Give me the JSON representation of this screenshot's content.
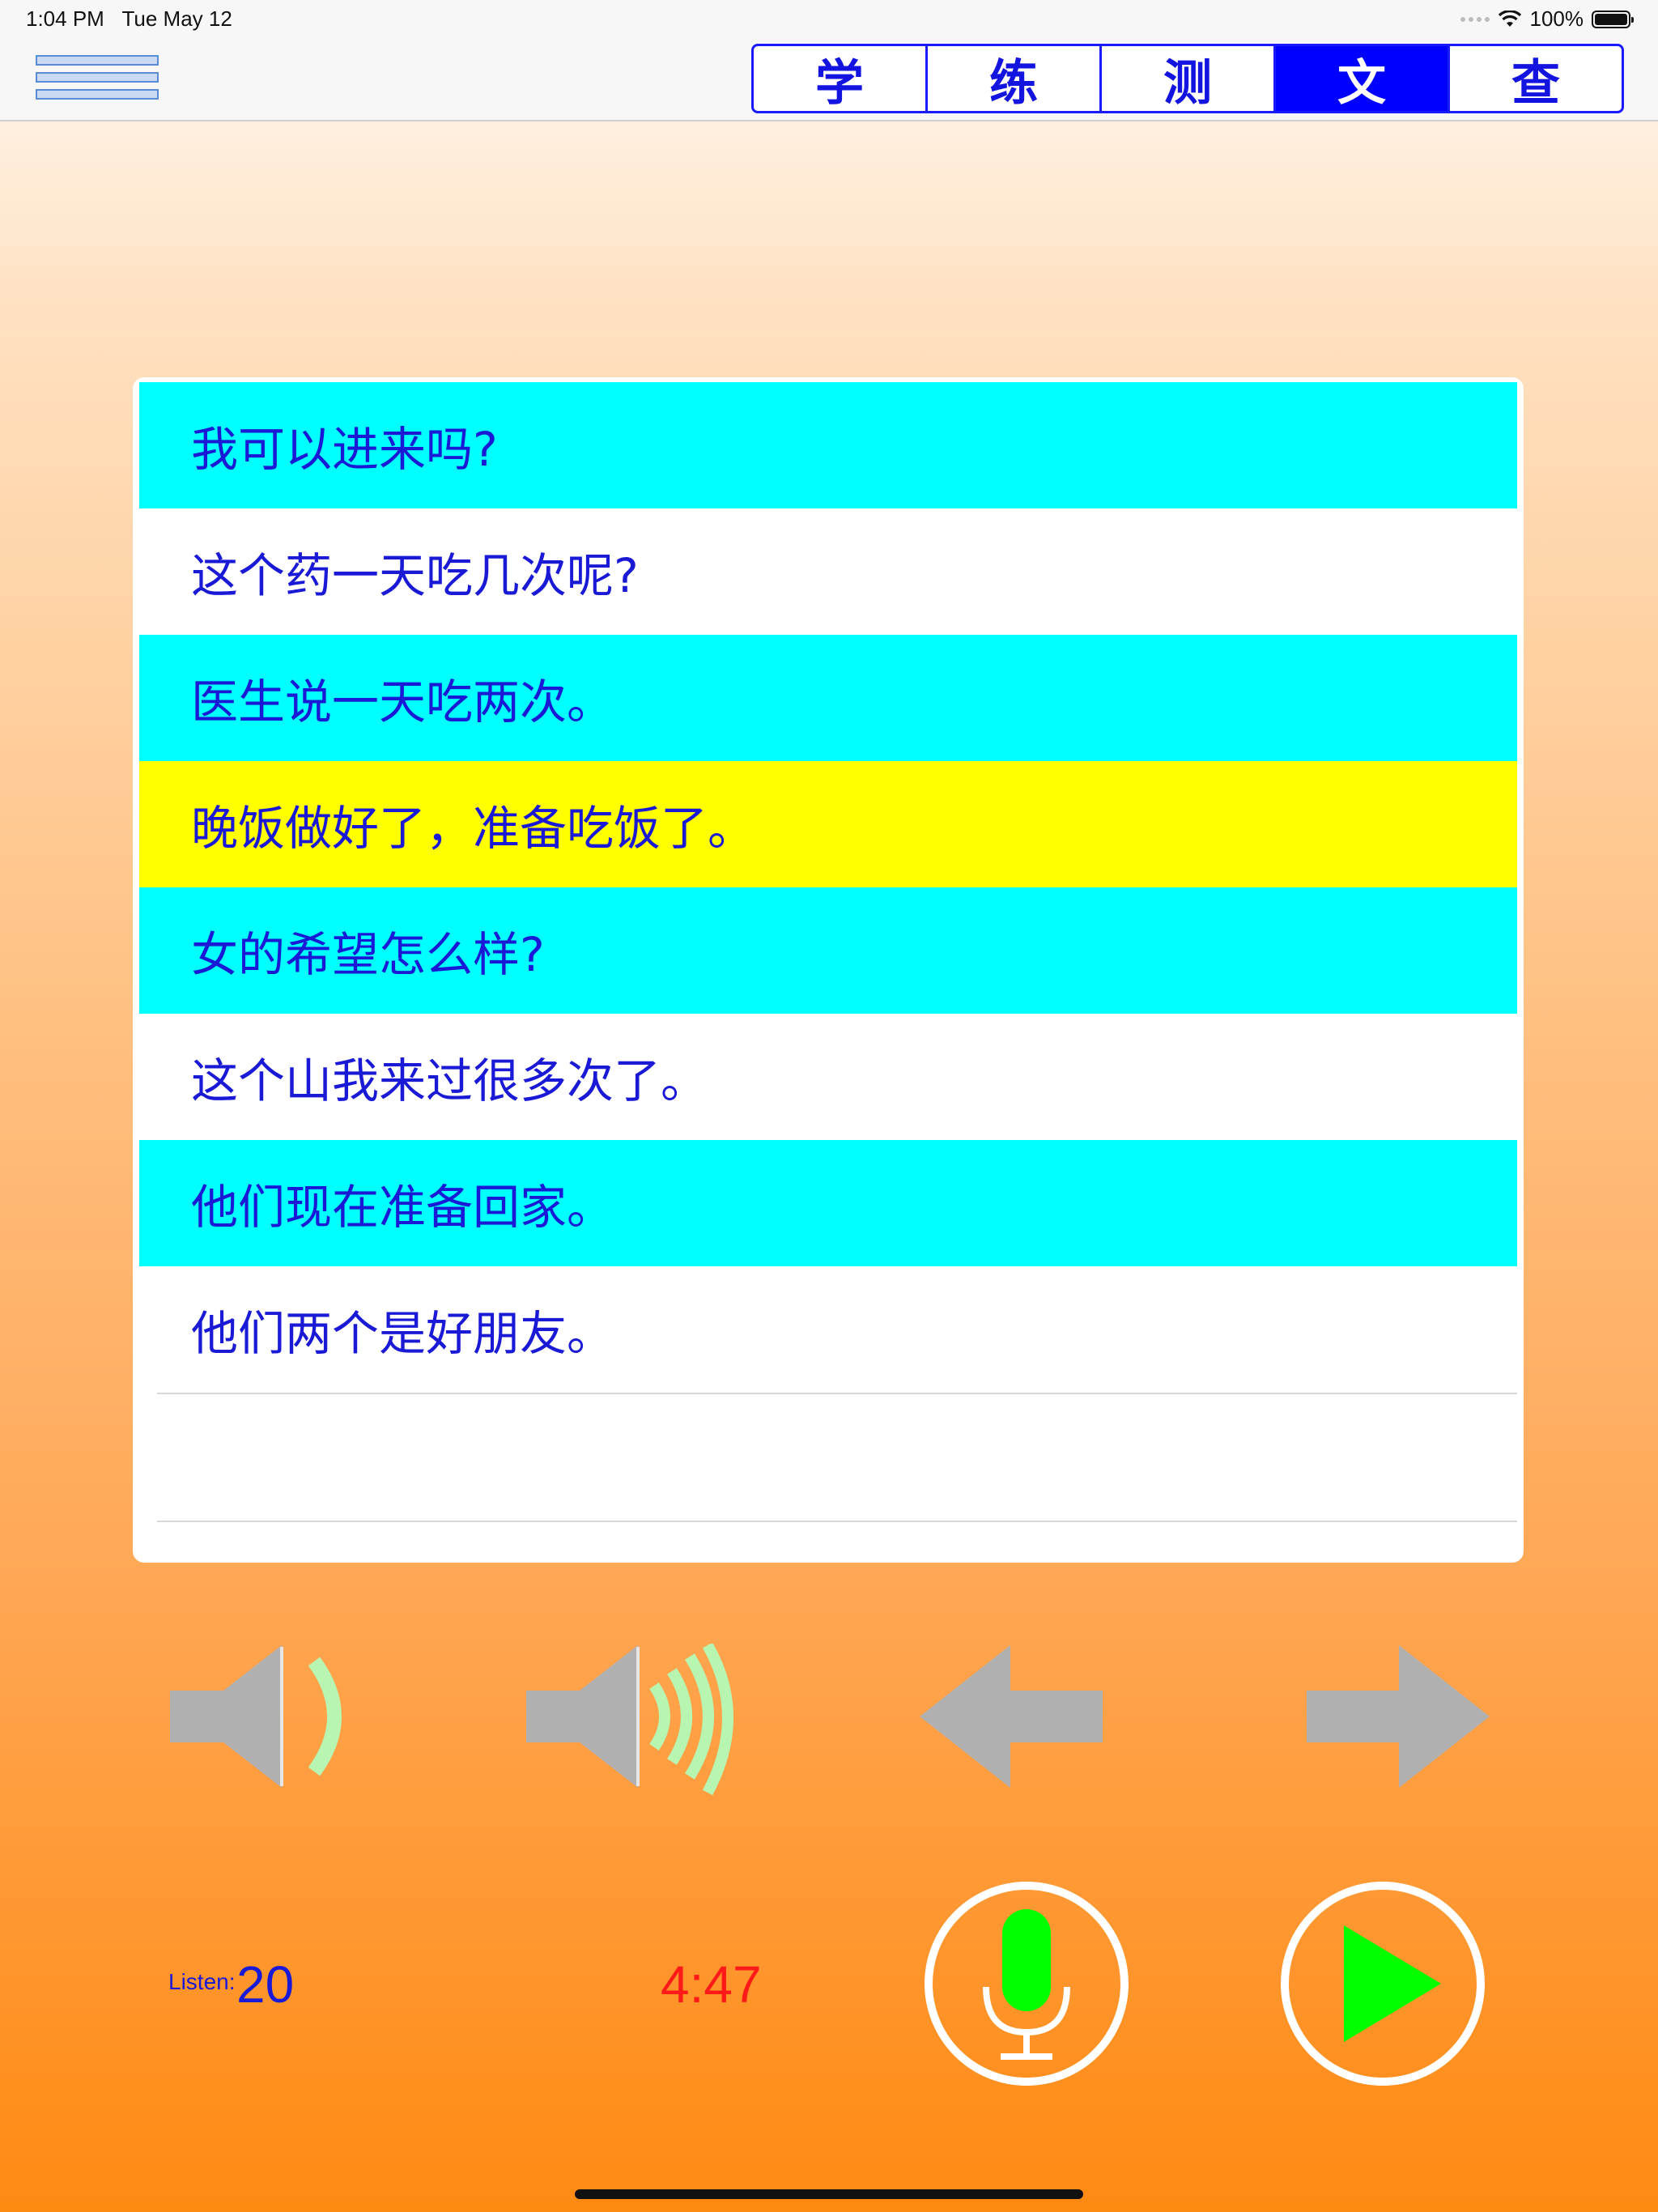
{
  "status_bar": {
    "time": "1:04 PM",
    "date": "Tue May 12",
    "battery": "100%"
  },
  "tabs": [
    {
      "label": "学",
      "active": false
    },
    {
      "label": "练",
      "active": false
    },
    {
      "label": "测",
      "active": false
    },
    {
      "label": "文",
      "active": true
    },
    {
      "label": "查",
      "active": false
    }
  ],
  "sentences": [
    {
      "text": "我可以进来吗?",
      "highlight": "cyan"
    },
    {
      "text": "这个药一天吃几次呢?",
      "highlight": "white"
    },
    {
      "text": "医生说一天吃两次。",
      "highlight": "cyan"
    },
    {
      "text": "晚饭做好了，准备吃饭了。",
      "highlight": "yellow"
    },
    {
      "text": "女的希望怎么样?",
      "highlight": "cyan"
    },
    {
      "text": "这个山我来过很多次了。",
      "highlight": "white"
    },
    {
      "text": "他们现在准备回家。",
      "highlight": "cyan"
    },
    {
      "text": "他们两个是好朋友。",
      "highlight": "white"
    }
  ],
  "controls": {
    "volume_down_icon": "speaker-low-icon",
    "volume_up_icon": "speaker-high-icon",
    "previous_icon": "arrow-left-icon",
    "next_icon": "arrow-right-icon",
    "record_icon": "microphone-icon",
    "play_icon": "play-icon"
  },
  "stats": {
    "listen_label": "Listen:",
    "listen_count": "20",
    "timer": "4:47"
  },
  "colors": {
    "accent": "#0000ff",
    "row_cyan": "#00ffff",
    "row_yellow": "#ffff00",
    "text_blue": "#1a1ad6",
    "timer_red": "#ff1a1a",
    "icon_gray": "#b0b0b0",
    "icon_green": "#00ff00"
  }
}
